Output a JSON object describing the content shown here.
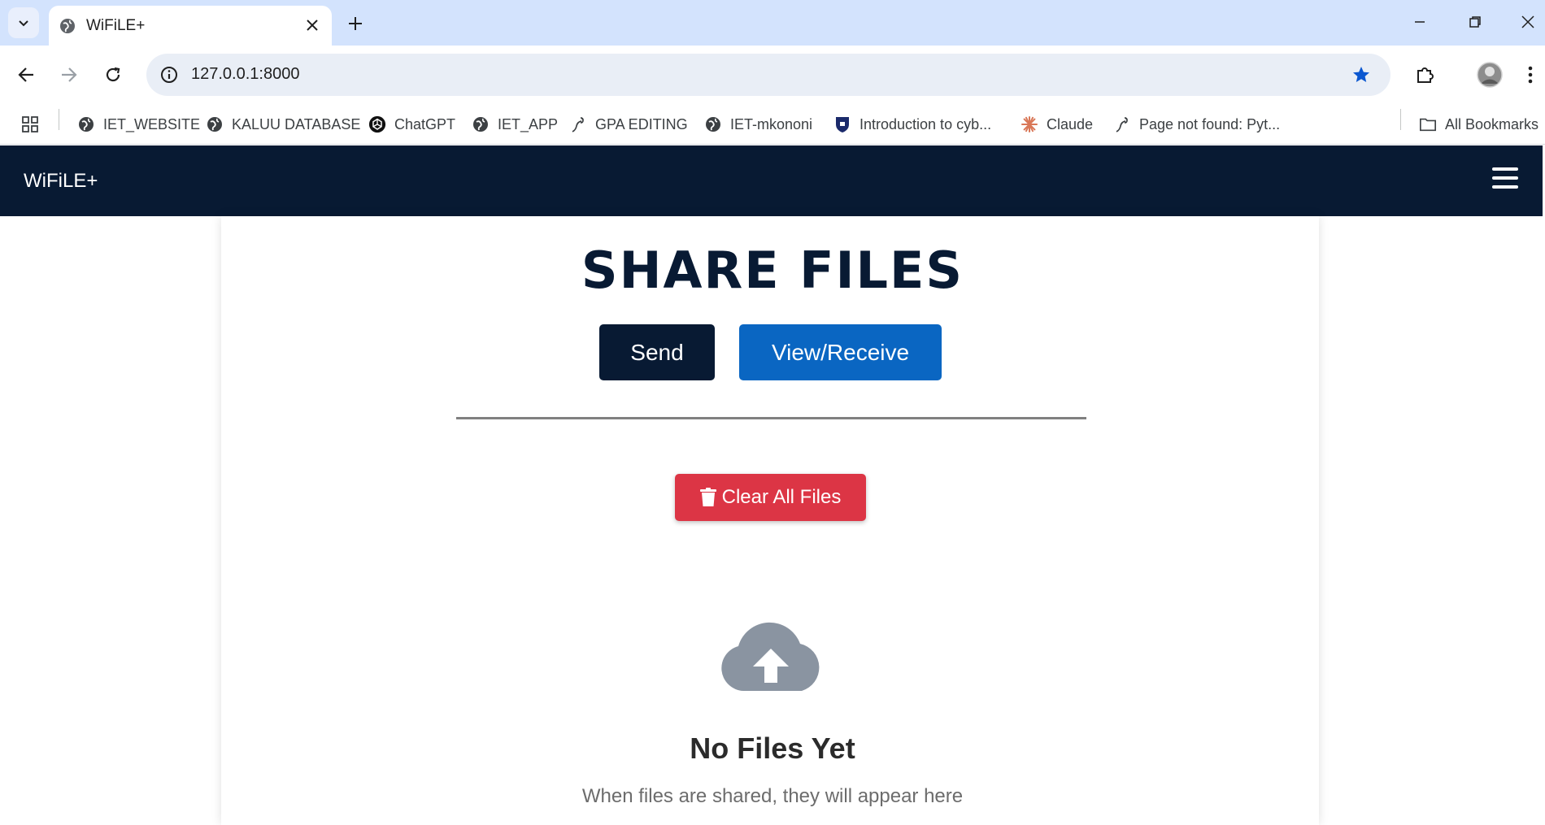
{
  "browser": {
    "tab_title": "WiFiLE+",
    "url": "127.0.0.1:8000",
    "bookmarks": [
      {
        "label": "IET_WEBSITE",
        "icon": "globe-icon"
      },
      {
        "label": "KALUU DATABASE",
        "icon": "globe-icon"
      },
      {
        "label": "ChatGPT",
        "icon": "chatgpt-icon"
      },
      {
        "label": "IET_APP",
        "icon": "globe-icon"
      },
      {
        "label": "GPA EDITING",
        "icon": "python-icon"
      },
      {
        "label": "IET-mkononi",
        "icon": "globe-icon"
      },
      {
        "label": "Introduction to cyb...",
        "icon": "shield-icon"
      },
      {
        "label": "Claude",
        "icon": "claude-icon"
      },
      {
        "label": "Page not found: Pyt...",
        "icon": "python-icon"
      }
    ],
    "all_bookmarks": "All Bookmarks"
  },
  "navbar": {
    "brand": "WiFiLE+"
  },
  "main": {
    "title": "SHARE FILES",
    "send_label": "Send",
    "view_label": "View/Receive",
    "clear_label": "Clear All Files",
    "empty_title": "No Files Yet",
    "empty_subtitle": "When files are shared, they will appear here"
  },
  "colors": {
    "navbar_bg": "#081a33",
    "send_bg": "#081a33",
    "view_bg": "#0a66c2",
    "clear_bg": "#dc3545",
    "cloud": "#8a94a1"
  }
}
